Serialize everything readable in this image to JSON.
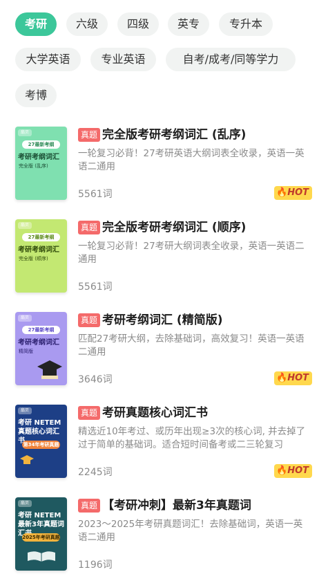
{
  "categories": [
    "考研",
    "六级",
    "四级",
    "英专",
    "专升本",
    "大学英语",
    "专业英语",
    "自考/成考/同等学力",
    "考博"
  ],
  "active_category": "考研",
  "books": [
    {
      "tag": "真题",
      "title": "完全版考研考纲词汇 (乱序)",
      "desc": "一轮复习必背！27考研英语大纲词表全收录，英语一英语二通用",
      "count": "5561词",
      "hot": true,
      "cover": {
        "brand": "扇贝",
        "ribbon": "27最新考纲",
        "title": "考研考纲词汇",
        "subtitle": "完全版 (乱序)",
        "bg": "#7fe0b0",
        "ribbon_bg": "#ffffff",
        "ribbon_color": "#2e8b57",
        "text_color": "#1a4d33"
      }
    },
    {
      "tag": "真题",
      "title": "完全版考研考纲词汇 (顺序)",
      "desc": "一轮复习必背！27考研大纲词表全收录，英语一英语二通用",
      "count": "5561词",
      "hot": false,
      "cover": {
        "brand": "扇贝",
        "ribbon": "27最新考纲",
        "title": "考研考纲词汇",
        "subtitle": "完全版 (顺序)",
        "bg": "#c3e872",
        "ribbon_bg": "#ffffff",
        "ribbon_color": "#5b8a1a",
        "text_color": "#2f4a0a"
      }
    },
    {
      "tag": "真题",
      "title": "考研考纲词汇 (精简版)",
      "desc": "匹配27考研大纲，去除基础词，高效复习！英语一英语二通用",
      "count": "3646词",
      "hot": true,
      "cover": {
        "brand": "扇贝",
        "ribbon": "27最新考纲",
        "title": "考研考纲词汇",
        "subtitle": "精简版",
        "bg": "#a99af0",
        "ribbon_bg": "#ffffff",
        "ribbon_color": "#5a48c8",
        "text_color": "#2c2070"
      }
    },
    {
      "tag": "真题",
      "title": "考研真题核心词汇书",
      "desc": "精选近10年考过、或历年出现≥3次的核心词, 并去掉了过于简单的基础词。适合短时间备考或二三轮复习",
      "count": "2245词",
      "hot": true,
      "cover": {
        "brand": "扇贝",
        "ribbon": "第34年考研真题",
        "title": "考研 NETEM 真题核心词汇书",
        "subtitle": "",
        "bg": "#1d3f86",
        "ribbon_bg": "#f0833a",
        "ribbon_color": "#ffffff",
        "text_color": "#ffffff"
      }
    },
    {
      "tag": "真题",
      "title": "【考研冲刺】最新3年真题词",
      "desc": "2023～2025年考研真题词汇！去除基础词，英语一英语二通用",
      "count": "1196词",
      "hot": false,
      "cover": {
        "brand": "扇贝",
        "ribbon": "2025年考研真题",
        "title": "考研 NETEM 最新3年真题词汇书",
        "subtitle": "",
        "bg": "#1f5960",
        "ribbon_bg": "#f2b33d",
        "ribbon_color": "#3a2a00",
        "text_color": "#ffffff"
      }
    }
  ],
  "hot_label": "HOT"
}
